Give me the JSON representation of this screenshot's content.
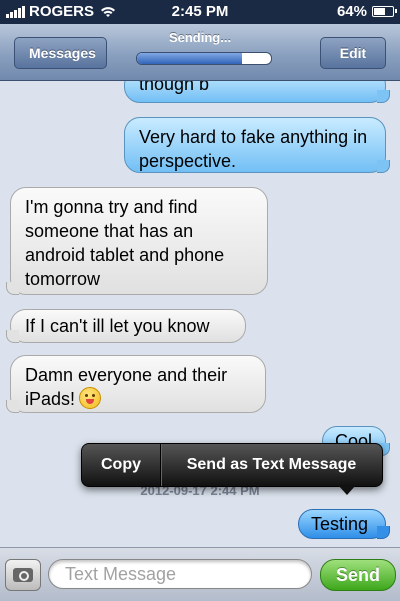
{
  "status_bar": {
    "carrier": "ROGERS",
    "time": "2:45 PM",
    "battery": "64%",
    "battery_level": 0.64
  },
  "nav": {
    "back_label": "Messages",
    "title": "Sending...",
    "progress": 0.78,
    "edit_label": "Edit"
  },
  "messages": [
    {
      "text": "though b",
      "direction": "outgoing"
    },
    {
      "text": "Very hard to fake anything in perspective.",
      "direction": "outgoing"
    },
    {
      "text": "I'm gonna try and find someone that has an android tablet and phone tomorrow",
      "direction": "incoming"
    },
    {
      "text": "If I can't ill let you know",
      "direction": "incoming"
    },
    {
      "text": "Damn everyone and their iPads!",
      "direction": "incoming",
      "emoji": "winking-tongue-face"
    },
    {
      "text": "Cool",
      "direction": "outgoing"
    },
    {
      "text": "Testing",
      "direction": "outgoing",
      "state": "sending"
    }
  ],
  "timestamp": "2012-09-17 2:44 PM",
  "context_menu": {
    "copy": "Copy",
    "send_as_text": "Send as Text Message"
  },
  "input": {
    "placeholder": "Text Message",
    "send_label": "Send"
  },
  "colors": {
    "outgoing_bubble": "#72bff5",
    "incoming_bubble": "#e0e0e0",
    "send_button": "#3da71b",
    "background": "#dbe2ed"
  }
}
